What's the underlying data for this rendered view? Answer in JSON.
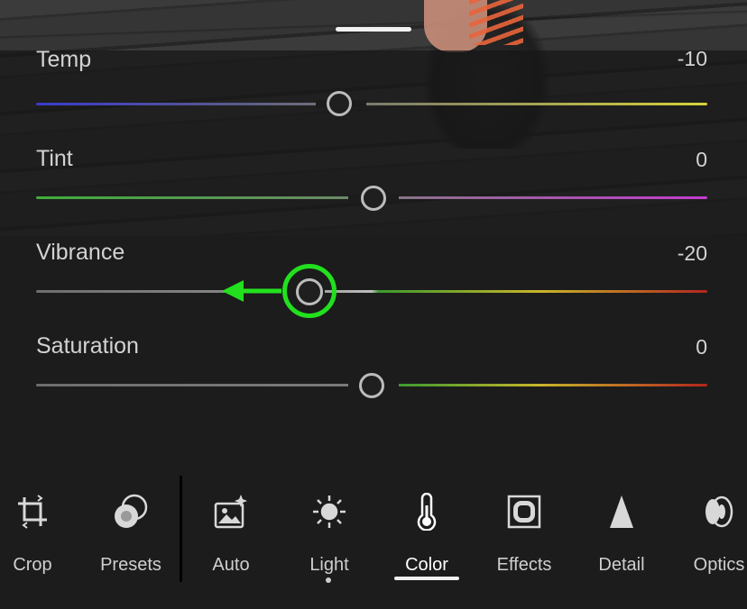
{
  "sliders": [
    {
      "key": "temp",
      "label": "Temp",
      "value": "-10",
      "position": 0.45
    },
    {
      "key": "tint",
      "label": "Tint",
      "value": "0",
      "position": 0.5
    },
    {
      "key": "vibrance",
      "label": "Vibrance",
      "value": "-20",
      "position": 0.4
    },
    {
      "key": "saturation",
      "label": "Saturation",
      "value": "0",
      "position": 0.5
    }
  ],
  "annotation": {
    "color": "#22e01e",
    "direction": "left"
  },
  "toolbar": {
    "tools": [
      {
        "label": "Crop",
        "icon": "crop-icon"
      },
      {
        "label": "Presets",
        "icon": "presets-icon"
      },
      {
        "label": "Auto",
        "icon": "auto-icon"
      },
      {
        "label": "Light",
        "icon": "light-icon"
      },
      {
        "label": "Color",
        "icon": "color-thermometer-icon",
        "active": true
      },
      {
        "label": "Effects",
        "icon": "effects-icon"
      },
      {
        "label": "Detail",
        "icon": "detail-icon"
      },
      {
        "label": "Optics",
        "icon": "optics-icon"
      }
    ]
  },
  "colors": {
    "temp_left": "#3a3ad0",
    "temp_right": "#d6d23a",
    "tint_left": "#3fae3a",
    "tint_right": "#c43ccf",
    "sat_green": "#3c9a2e",
    "sat_yellow": "#c8b52a",
    "sat_red": "#b3261e"
  }
}
